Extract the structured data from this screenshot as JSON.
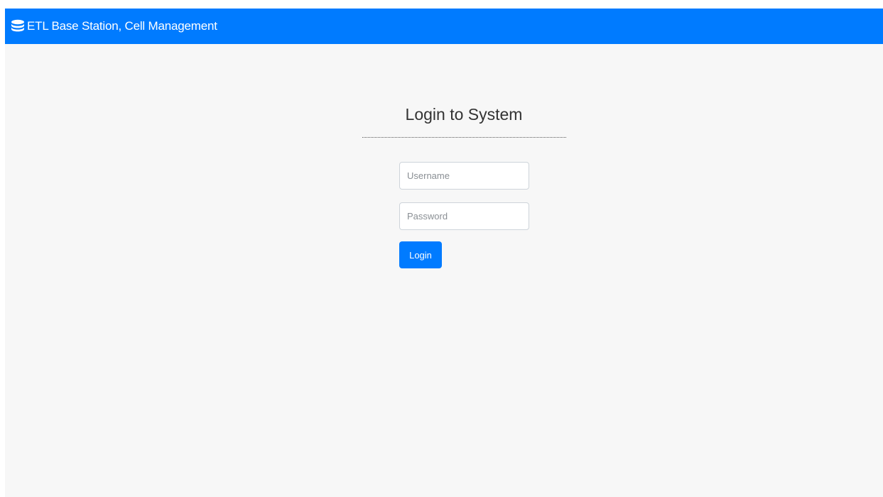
{
  "header": {
    "brand_icon": "database-icon",
    "brand_title": "ETL Base Station, Cell Management",
    "background_color": "#007bff"
  },
  "login": {
    "title": "Login to System",
    "username_placeholder": "Username",
    "username_value": "",
    "password_placeholder": "Password",
    "password_value": "",
    "submit_label": "Login",
    "button_color": "#007bff"
  }
}
